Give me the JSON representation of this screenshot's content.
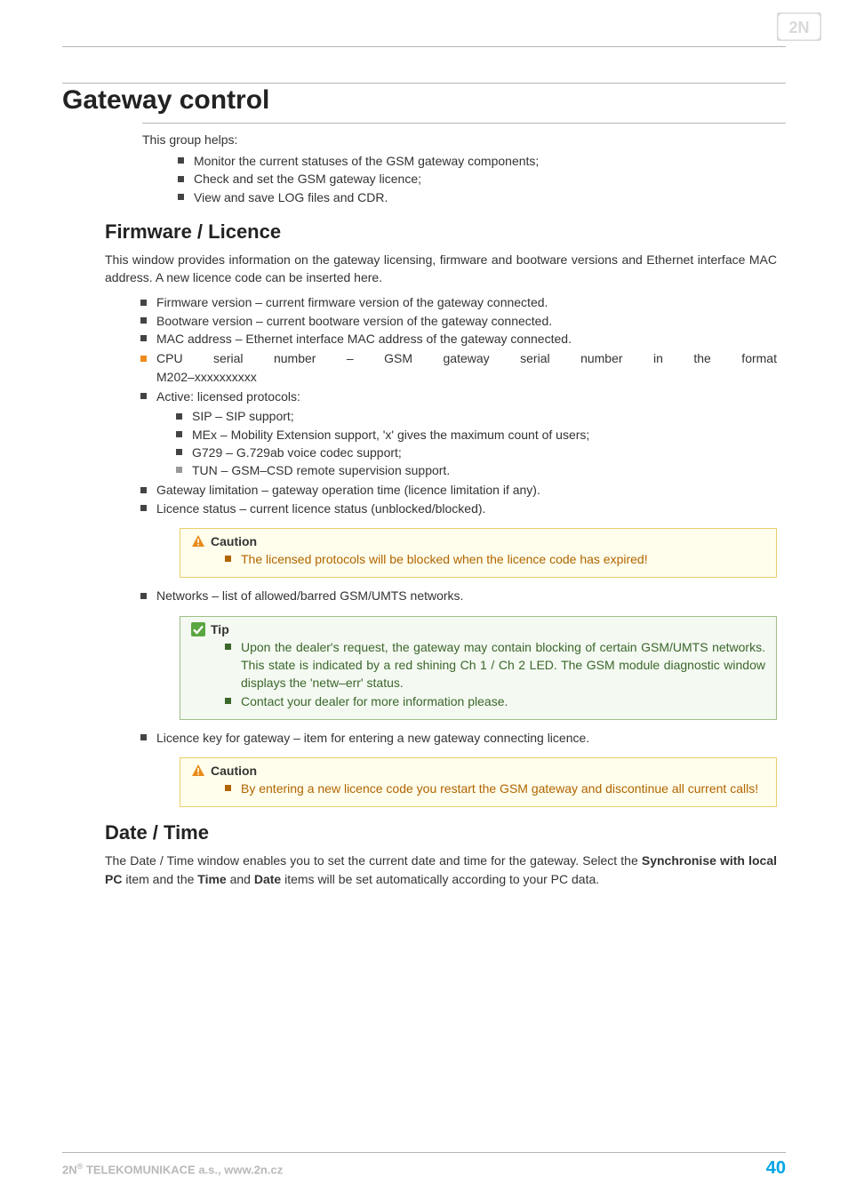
{
  "header": {
    "logo_text": "2N"
  },
  "title": "Gateway control",
  "intro": "This group helps:",
  "intro_bullets": [
    "Monitor the current statuses of the GSM gateway components;",
    "Check and set the GSM gateway licence;",
    "View and save LOG files and CDR."
  ],
  "sections": {
    "firmware": {
      "heading": "Firmware / Licence",
      "para": "This window provides information on the gateway licensing, firmware and bootware versions and Ethernet interface MAC address. A new licence code can be inserted here.",
      "bullets1": [
        "Firmware version – current firmware version of the gateway connected.",
        "Bootware version – current bootware version of the gateway connected.",
        "MAC address – Ethernet interface MAC address of the gateway connected."
      ],
      "cpu_line1": "CPU serial number – GSM gateway serial number in the format",
      "cpu_line2": "M202–xxxxxxxxxx",
      "active_label": "Active: licensed protocols:",
      "protocols": [
        "SIP – SIP support;",
        "MEx – Mobility Extension support, 'x' gives the maximum count of users;",
        "G729 – G.729ab voice codec support;"
      ],
      "protocol_grey": "TUN – GSM–CSD remote supervision support.",
      "bullets2": [
        "Gateway limitation – gateway operation time (licence limitation if any).",
        "Licence status – current licence status (unblocked/blocked)."
      ],
      "caution1": {
        "label": "Caution",
        "items": [
          "The licensed protocols will be blocked when the licence code has expired!"
        ]
      },
      "networks_bullet": "Networks – list of allowed/barred GSM/UMTS networks.",
      "tip": {
        "label": "Tip",
        "items": [
          "Upon the dealer's request, the gateway may contain blocking of certain GSM/UMTS networks. This state is indicated by a red shining Ch 1 / Ch 2 LED. The GSM module diagnostic window displays the 'netw–err' status.",
          "Contact your dealer for more information please."
        ]
      },
      "licence_key_bullet": "Licence key for gateway – item for entering a new gateway connecting licence.",
      "caution2": {
        "label": "Caution",
        "items": [
          "By entering a new licence code you restart the GSM gateway and discontinue all current calls!"
        ]
      }
    },
    "datetime": {
      "heading": "Date / Time",
      "para_pre": "The Date / Time window enables you to set the current date and time for the gateway. Select the ",
      "bold1": "Synchronise with local PC",
      "mid1": " item and the ",
      "bold2": "Time",
      "mid2": " and ",
      "bold3": "Date",
      "para_post": " items will be set automatically according to your PC data."
    }
  },
  "footer": {
    "company_prefix": "2N",
    "reg": "®",
    "company_rest": " TELEKOMUNIKACE a.s., www.2n.cz",
    "page": "40"
  }
}
